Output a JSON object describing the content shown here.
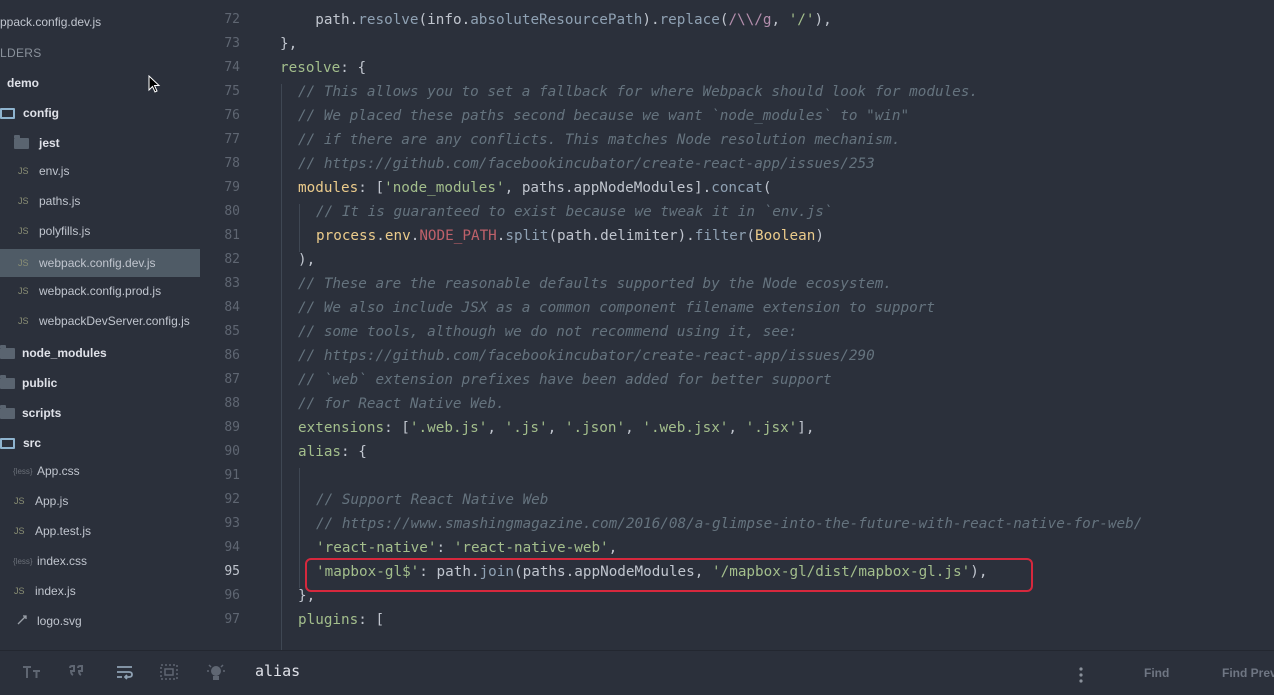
{
  "sidebar": {
    "items": [
      {
        "label": "ppack.config.dev.js",
        "icon": "none"
      },
      {
        "label": "LDERS",
        "icon": "none"
      },
      {
        "label": "demo",
        "icon": "none"
      },
      {
        "label": "config",
        "icon": "folder-open"
      },
      {
        "label": "jest",
        "icon": "folder-closed"
      },
      {
        "label": "env.js",
        "icon": "JS"
      },
      {
        "label": "paths.js",
        "icon": "JS"
      },
      {
        "label": "polyfills.js",
        "icon": "JS"
      },
      {
        "label": "webpack.config.dev.js",
        "icon": "JS"
      },
      {
        "label": "webpack.config.prod.js",
        "icon": "JS"
      },
      {
        "label": "webpackDevServer.config.js",
        "icon": "JS"
      },
      {
        "label": "node_modules",
        "icon": "folder-closed"
      },
      {
        "label": "public",
        "icon": "folder-closed"
      },
      {
        "label": "scripts",
        "icon": "folder-closed"
      },
      {
        "label": "src",
        "icon": "folder-open"
      },
      {
        "label": "App.css",
        "icon": "{less}"
      },
      {
        "label": "App.js",
        "icon": "JS"
      },
      {
        "label": "App.test.js",
        "icon": "JS"
      },
      {
        "label": "index.css",
        "icon": "{less}"
      },
      {
        "label": "index.js",
        "icon": "JS"
      },
      {
        "label": "logo.svg",
        "icon": "svg"
      }
    ],
    "selected": "webpack.config.dev.js"
  },
  "gutter": {
    "line_numbers": [
      "72",
      "73",
      "74",
      "75",
      "76",
      "77",
      "78",
      "79",
      "80",
      "81",
      "82",
      "83",
      "84",
      "85",
      "86",
      "87",
      "88",
      "89",
      "90",
      "91",
      "92",
      "93",
      "94",
      "95",
      "96",
      "97"
    ],
    "active_line": "95"
  },
  "code": {
    "l72a": "  path.",
    "l72b": "resolve",
    "l72c": "(info.",
    "l72d": "absoluteResourcePath",
    "l72e": ").",
    "l72f": "replace",
    "l72g": "(",
    "l72h": "/\\\\/g",
    "l72i": ", ",
    "l72j": "'/'",
    "l72k": "),",
    "l73": "},",
    "l74a": "resolve",
    "l74b": ": {",
    "l75": "// This allows you to set a fallback for where Webpack should look for modules.",
    "l76": "// We placed these paths second because we want `node_modules` to \"win\"",
    "l77": "// if there are any conflicts. This matches Node resolution mechanism.",
    "l78": "// https://github.com/facebookincubator/create-react-app/issues/253",
    "l79a": "modules",
    "l79b": ": [",
    "l79c": "'node_modules'",
    "l79d": ", paths.",
    "l79e": "appNodeModules",
    "l79f": "].",
    "l79g": "concat",
    "l79h": "(",
    "l80": "// It is guaranteed to exist because we tweak it in `env.js`",
    "l81a": "process",
    "l81b": ".",
    "l81c": "env",
    "l81d": ".",
    "l81e": "NODE_PATH",
    "l81f": ".",
    "l81g": "split",
    "l81h": "(path.",
    "l81i": "delimiter",
    "l81j": ").",
    "l81k": "filter",
    "l81l": "(",
    "l81m": "Boolean",
    "l81n": ")",
    "l82": "),",
    "l83": "// These are the reasonable defaults supported by the Node ecosystem.",
    "l84": "// We also include JSX as a common component filename extension to support",
    "l85": "// some tools, although we do not recommend using it, see:",
    "l86": "// https://github.com/facebookincubator/create-react-app/issues/290",
    "l87": "// `web` extension prefixes have been added for better support",
    "l88": "// for React Native Web.",
    "l89a": "extensions",
    "l89b": ": [",
    "l89c": "'.web.js'",
    "l89d": ", ",
    "l89e": "'.js'",
    "l89f": ", ",
    "l89g": "'.json'",
    "l89h": ", ",
    "l89i": "'.web.jsx'",
    "l89j": ", ",
    "l89k": "'.jsx'",
    "l89l": "],",
    "l90a": "alias",
    "l90b": ": {",
    "l92": "// Support React Native Web",
    "l93": "// https://www.smashingmagazine.com/2016/08/a-glimpse-into-the-future-with-react-native-for-web/",
    "l94a": "'react-native'",
    "l94b": ": ",
    "l94c": "'react-native-web'",
    "l94d": ",",
    "l95a": "'mapbox-gl$'",
    "l95b": ": path.",
    "l95c": "join",
    "l95d": "(paths.",
    "l95e": "appNodeModules",
    "l95f": ", ",
    "l95g": "'/mapbox-gl/dist/mapbox-gl.js'",
    "l95h": "),",
    "l96": "},",
    "l97a": "plugins",
    "l97b": ": ["
  },
  "bottombar": {
    "find_value": "alias",
    "find_label": "Find",
    "find_prev_label": "Find Prev"
  }
}
